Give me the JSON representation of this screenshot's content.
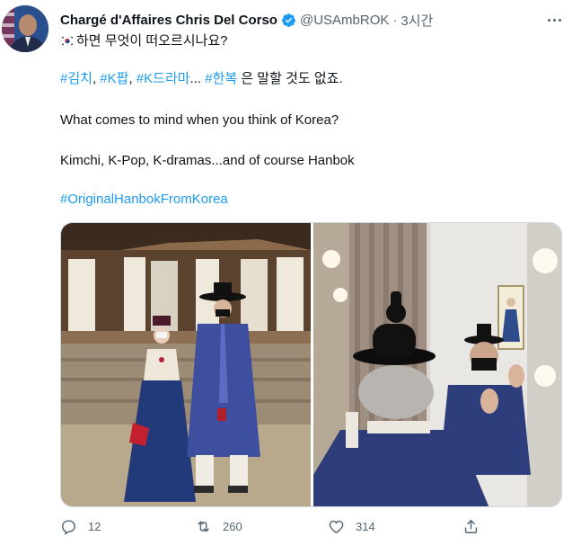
{
  "tweet": {
    "author": {
      "display_name": "Chargé d'Affaires Chris Del Corso",
      "handle": "@USAmbROK",
      "verified": true,
      "avatar_icon": "avatar-photo"
    },
    "separator": "·",
    "timestamp": "3시간",
    "more_icon": "more-dots-icon",
    "body": {
      "line1_flag_icon": "south-korea-flag-icon",
      "line1_text": "하면 무엇이 떠오르시나요?",
      "hashtags_line": [
        {
          "text": "#김치",
          "after": ", "
        },
        {
          "text": "#K팝",
          "after": ", "
        },
        {
          "text": "#K드라마",
          "after": "... "
        },
        {
          "text": "#한복",
          "after": ""
        }
      ],
      "hashtags_line_tail": " 은 말할 것도 없죠.",
      "english_question": "What comes to mind when you think of Korea?",
      "english_answer": "Kimchi, K-Pop, K-dramas...and of course Hanbok",
      "final_hashtag": "#OriginalHanbokFromKorea"
    },
    "media": [
      {
        "icon": "hanbok-couple-photo"
      },
      {
        "icon": "mirror-selfie-photo"
      }
    ],
    "actions": {
      "reply_count": "12",
      "retweet_count": "260",
      "like_count": "314",
      "share_icon": "share-icon"
    },
    "colors": {
      "link": "#1d9bf0",
      "text": "#0f1419",
      "secondary": "#536471"
    }
  }
}
